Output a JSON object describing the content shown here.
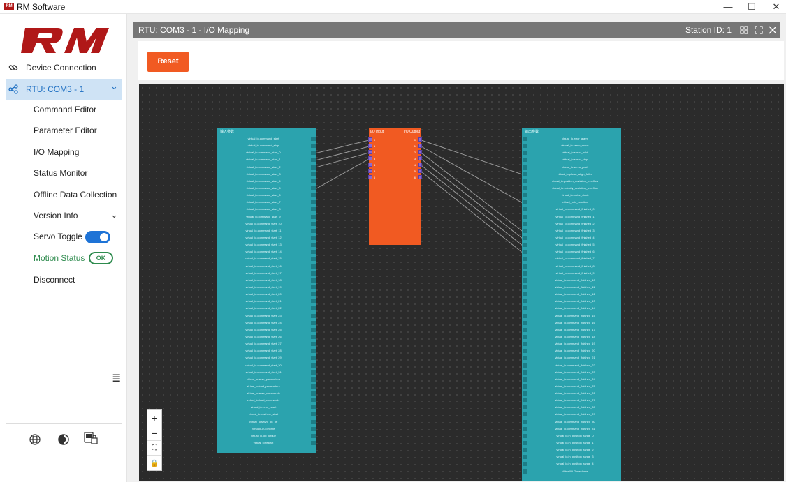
{
  "window": {
    "app_icon": "RM",
    "title": "RM Software",
    "controls": {
      "minimize": "—",
      "maximize": "☐",
      "close": "✕"
    }
  },
  "sidebar": {
    "logo_text": "RM",
    "logo_color": "#b01818",
    "items": [
      {
        "label": "Device Connection",
        "icon": "link-icon"
      },
      {
        "label": "RTU: COM3 - 1",
        "icon": "nodes-icon",
        "active": true,
        "chevron": "⌄"
      }
    ],
    "sub_items": [
      "Command Editor",
      "Parameter Editor",
      "I/O Mapping",
      "Status Monitor",
      "Offline Data Collection",
      "Version Info"
    ],
    "servo_toggle_label": "Servo Toggle",
    "servo_toggle_on": true,
    "motion_status_label": "Motion Status",
    "motion_status_value": "OK",
    "disconnect_label": "Disconnect",
    "collapse_icon": "≣",
    "bottom_icons": [
      "globe-icon",
      "theme-icon",
      "device-lock-icon"
    ]
  },
  "panel": {
    "title": "RTU: COM3 - 1 - I/O Mapping",
    "station_id": "Station ID: 1",
    "header_icons": [
      "grid-icon",
      "fullscreen-icon",
      "close-icon"
    ]
  },
  "toolbar": {
    "reset_label": "Reset",
    "reset_color": "#f15a22"
  },
  "graph": {
    "input_node": {
      "title": "输入参数",
      "ports": [
        "virtual_io.command_start",
        "virtual_io.command_stop",
        "virtual_io.command_start_0",
        "virtual_io.command_start_1",
        "virtual_io.command_start_2",
        "virtual_io.command_start_3",
        "virtual_io.command_start_4",
        "virtual_io.command_start_5",
        "virtual_io.command_start_6",
        "virtual_io.command_start_7",
        "virtual_io.command_start_8",
        "virtual_io.command_start_9",
        "virtual_io.command_start_10",
        "virtual_io.command_start_11",
        "virtual_io.command_start_12",
        "virtual_io.command_start_13",
        "virtual_io.command_start_14",
        "virtual_io.command_start_15",
        "virtual_io.command_start_16",
        "virtual_io.command_start_17",
        "virtual_io.command_start_18",
        "virtual_io.command_start_19",
        "virtual_io.command_start_20",
        "virtual_io.command_start_21",
        "virtual_io.command_start_22",
        "virtual_io.command_start_23",
        "virtual_io.command_start_24",
        "virtual_io.command_start_25",
        "virtual_io.command_start_26",
        "virtual_io.command_start_27",
        "virtual_io.command_start_28",
        "virtual_io.command_start_29",
        "virtual_io.command_start_30",
        "virtual_io.command_start_31",
        "virtual_io.save_parameters",
        "virtual_io.load_parameters",
        "virtual_io.save_commands",
        "virtual_io.load_commands",
        "virtual_io.error_reset",
        "virtual_io.machine_start",
        "virtual_io.servo_on_off",
        "VirtualIO.GoHome",
        "virtual_io.jog_torque",
        "virtual_io.restart"
      ]
    },
    "io_node": {
      "input_label": "I/O Input",
      "output_label": "I/O Output",
      "input_ports": [
        "0",
        "1",
        "2",
        "3",
        "4",
        "5",
        "6"
      ],
      "output_ports": [
        "0",
        "1",
        "2",
        "3",
        "4",
        "5",
        "6"
      ]
    },
    "output_node": {
      "title": "输出参数",
      "ports": [
        "virtual_io.error_alarm",
        "virtual_io.servo_move",
        "virtual_io.servo_hold",
        "virtual_io.servo_stop",
        "virtual_io.servo_push",
        "virtual_io.phase_align_failed",
        "virtual_io.position_deviation_overflow",
        "virtual_io.velocity_deviation_overflow",
        "virtual_io.motor_stuck",
        "virtual_io.in_position",
        "virtual_io.command_finished_0",
        "virtual_io.command_finished_1",
        "virtual_io.command_finished_2",
        "virtual_io.command_finished_3",
        "virtual_io.command_finished_4",
        "virtual_io.command_finished_5",
        "virtual_io.command_finished_6",
        "virtual_io.command_finished_7",
        "virtual_io.command_finished_8",
        "virtual_io.command_finished_9",
        "virtual_io.command_finished_10",
        "virtual_io.command_finished_11",
        "virtual_io.command_finished_12",
        "virtual_io.command_finished_13",
        "virtual_io.command_finished_14",
        "virtual_io.command_finished_15",
        "virtual_io.command_finished_16",
        "virtual_io.command_finished_17",
        "virtual_io.command_finished_18",
        "virtual_io.command_finished_19",
        "virtual_io.command_finished_20",
        "virtual_io.command_finished_21",
        "virtual_io.command_finished_22",
        "virtual_io.command_finished_23",
        "virtual_io.command_finished_24",
        "virtual_io.command_finished_25",
        "virtual_io.command_finished_26",
        "virtual_io.command_finished_27",
        "virtual_io.command_finished_28",
        "virtual_io.command_finished_29",
        "virtual_io.command_finished_30",
        "virtual_io.command_finished_31",
        "virtual_io.in_position_range_0",
        "virtual_io.in_position_range_1",
        "virtual_io.in_position_range_2",
        "virtual_io.in_position_range_3",
        "virtual_io.in_position_range_4",
        "VirtualIO.GoneHome"
      ]
    },
    "links_in": [
      [
        2,
        0
      ],
      [
        3,
        1
      ],
      [
        4,
        2
      ],
      [
        7,
        3
      ]
    ],
    "links_out": [
      [
        0,
        5
      ],
      [
        1,
        9
      ],
      [
        2,
        13
      ],
      [
        3,
        14
      ],
      [
        4,
        15
      ],
      [
        5,
        16
      ]
    ],
    "zoom_controls": [
      "+",
      "−",
      "⛶",
      "🔒"
    ]
  }
}
